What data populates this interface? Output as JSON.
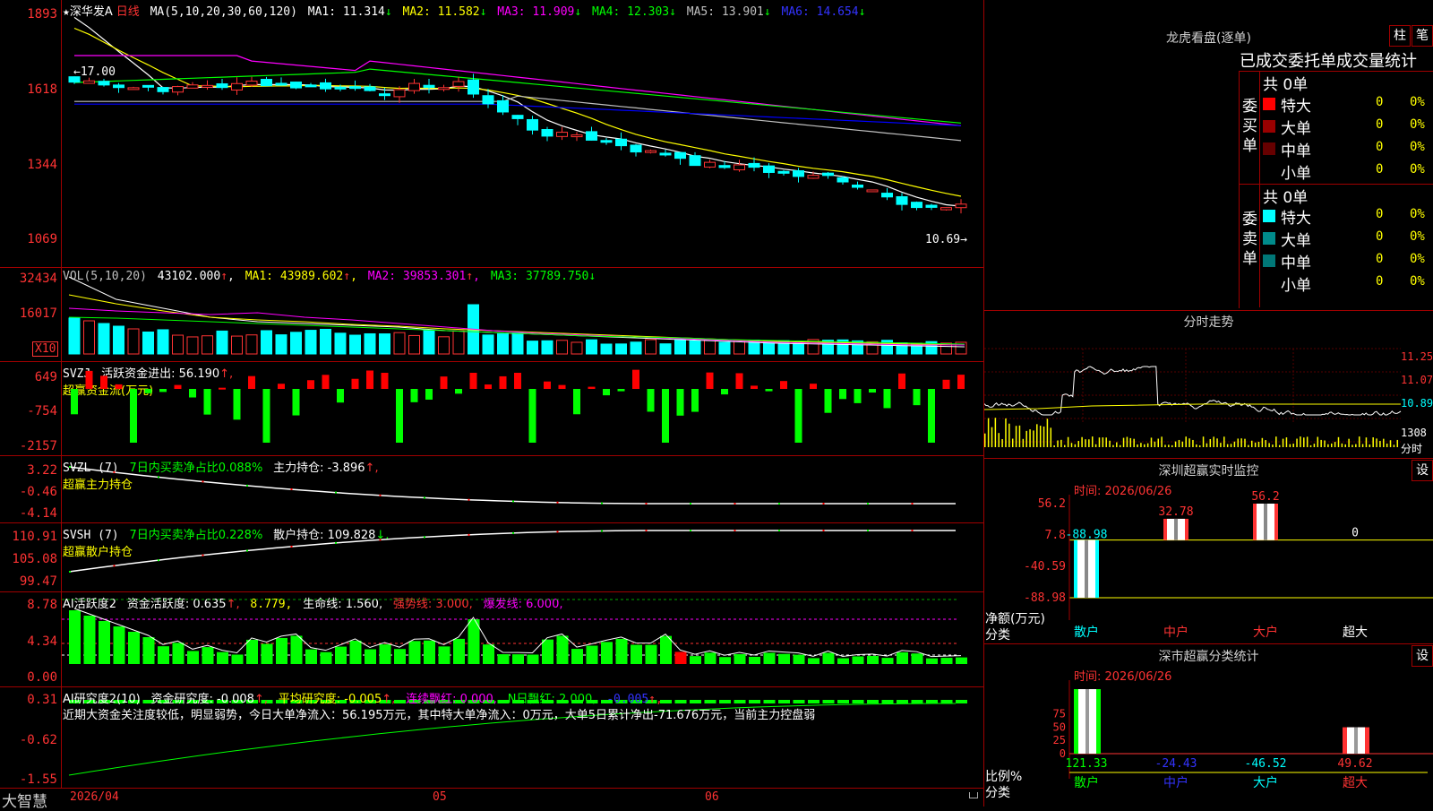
{
  "colors": {
    "up": "#ff3333",
    "down": "#00ffff",
    "ma1": "#ffffff",
    "ma2": "#ffff00",
    "ma3": "#ff00ff",
    "ma4": "#00ff00",
    "ma5": "#c0c0c0",
    "ma6": "#0000ff",
    "pos": "#ff0000",
    "neg": "#00ff00"
  },
  "main": {
    "star": "★",
    "name": "深华发A",
    "period": "日线",
    "ma_label": "MA(5,10,20,30,60,120)",
    "ma1": "MA1: 11.314",
    "ma2": "MA2: 11.582",
    "ma3": "MA3: 11.909",
    "ma4": "MA4: 12.303",
    "ma5": "MA5: 13.901",
    "ma6": "MA6: 14.654",
    "arrows": {
      "ma1": "↓",
      "ma2": "↓",
      "ma3": "↓",
      "ma4": "↓",
      "ma5": "↓",
      "ma6": "↓"
    },
    "ticks": [
      "1893",
      "1618",
      "1344",
      "1069"
    ],
    "high_note": "17.00",
    "low_note": "10.69"
  },
  "vol": {
    "label": "VOL(5,10,20)",
    "value": "43102.000",
    "ma1": "MA1: 43989.602",
    "ma2": "MA2: 39853.301",
    "ma3": "MA3: 37789.750",
    "arrows": [
      "↑",
      "↑",
      "↑",
      "↓"
    ],
    "ticks": [
      "32434",
      "16017"
    ],
    "unit": "X10"
  },
  "svzj": {
    "label": "SVZJ",
    "text1": "活跃资金进出: 56.190",
    "arrow": "↑,",
    "text2": "超赢资金流(万元)",
    "ticks": [
      "649",
      "-754",
      "-2157"
    ]
  },
  "svzl": {
    "label": "SVZL (7)",
    "text1": "7日内买卖净占比0.088%",
    "text2": "主力持仓: -3.896",
    "arrow": "↑,",
    "text3": "超赢主力持仓",
    "ticks": [
      "3.22",
      "-0.46",
      "-4.14"
    ]
  },
  "svsh": {
    "label": "SVSH (7)",
    "text1": "7日内买卖净占比0.228%",
    "text2": "散户持仓: 109.828",
    "arrow": "↓,",
    "text3": "超赢散户持仓",
    "ticks": [
      "110.91",
      "105.08",
      "99.47"
    ]
  },
  "ai": {
    "label": "AI活跃度2",
    "t1": "资金活跃度: 0.635",
    "a1": "↑,",
    "t2": "8.779,",
    "t3": "生命线: 1.560,",
    "t4": "强势线: 3.000,",
    "t5": "爆发线: 6.000,",
    "ticks": [
      "8.78",
      "4.34",
      "0.00"
    ]
  },
  "ai2": {
    "label": "AI研究度2(10)",
    "t1": "资金研究度: -0.008",
    "a1": "↑,",
    "t2": "平均研究度: -0.005",
    "a2": "↑,",
    "t3": "连续飘红: 0.000,",
    "t4": "N日飘红: 2.000,",
    "t5": "-0.005",
    "a5": "↑,",
    "note": "近期大资金关注度较低，明显弱势，今日大单净流入：56.195万元，其中特大单净流入：0万元，大单5日累计净出-71.676万元，当前主力控盘弱",
    "ticks": [
      "0.31",
      "-0.62",
      "-1.55"
    ]
  },
  "footer": {
    "brand": "大智慧",
    "date1": "2026/04",
    "date2": "05",
    "date3": "06"
  },
  "right": {
    "title": "龙虎看盘(逐单)",
    "btn1": "柱",
    "btn2": "笔",
    "stats_title": "已成交委托单成交量统计",
    "buy": {
      "side": "委买单",
      "total": "共 0单",
      "rows": [
        {
          "label": "特大",
          "v": "0",
          "p": "0%",
          "c": "#ff0000"
        },
        {
          "label": "大单",
          "v": "0",
          "p": "0%",
          "c": "#990000"
        },
        {
          "label": "中单",
          "v": "0",
          "p": "0%",
          "c": "#660000"
        },
        {
          "label": "小单",
          "v": "0",
          "p": "0%",
          "c": "#000000"
        }
      ]
    },
    "sell": {
      "side": "委卖单",
      "total": "共 0单",
      "rows": [
        {
          "label": "特大",
          "v": "0",
          "p": "0%",
          "c": "#00ffff"
        },
        {
          "label": "大单",
          "v": "0",
          "p": "0%",
          "c": "#008b8b"
        },
        {
          "label": "中单",
          "v": "0",
          "p": "0%",
          "c": "#007777"
        },
        {
          "label": "小单",
          "v": "0",
          "p": "0%",
          "c": "#000000"
        }
      ]
    },
    "minute": {
      "title": "分时走势",
      "ticks": [
        "11.25",
        "11.07",
        "10.89"
      ],
      "vol_tick": "1308",
      "vol_label": "分时"
    },
    "monitor": {
      "title": "深圳超赢实时监控",
      "set": "设",
      "time": "时间: 2026/06/26",
      "ticks": [
        "56.2",
        "7.8",
        "-40.59",
        "-88.98"
      ],
      "unit": "净额(万元)",
      "cat": "分类",
      "cats": [
        "散户",
        "中户",
        "大户",
        "超大"
      ],
      "values": [
        -88.98,
        32.78,
        56.2,
        0
      ],
      "labels": [
        "-88.98",
        "32.78",
        "56.2",
        "0"
      ]
    },
    "cls": {
      "title": "深市超赢分类统计",
      "set": "设",
      "time": "时间: 2026/06/26",
      "ticks": [
        "75",
        "50",
        "25",
        "0"
      ],
      "unit": "比例%",
      "cat": "分类",
      "cats": [
        "散户",
        "中户",
        "大户",
        "超大"
      ],
      "values": [
        121.33,
        -24.43,
        -46.52,
        49.62
      ],
      "labels": [
        "121.33",
        "-24.43",
        "-46.52",
        "49.62"
      ]
    }
  }
}
